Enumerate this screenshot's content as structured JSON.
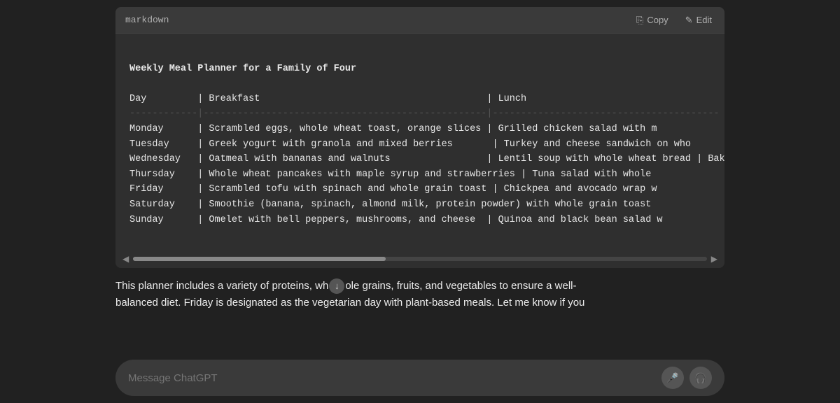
{
  "code_block": {
    "lang": "markdown",
    "title": "Weekly Meal Planner for a Family of Four",
    "copy_label": "Copy",
    "edit_label": "Edit",
    "headers": {
      "day": "Day",
      "breakfast": "Breakfast",
      "lunch": "Lunch"
    },
    "separator": "------------|------------------------------------------|--------------------------------------------",
    "rows": [
      {
        "day": "Monday",
        "breakfast": "Scrambled eggs, whole wheat toast, orange slices",
        "lunch": "Grilled chicken salad with m"
      },
      {
        "day": "Tuesday",
        "breakfast": "Greek yogurt with granola and mixed berries",
        "lunch": "Turkey and cheese sandwich on who"
      },
      {
        "day": "Wednesday",
        "breakfast": "Oatmeal with bananas and walnuts",
        "lunch": "Lentil soup with whole wheat bread | Baked c"
      },
      {
        "day": "Thursday",
        "breakfast": "Whole wheat pancakes with maple syrup and strawberries",
        "lunch": "Tuna salad with whole"
      },
      {
        "day": "Friday",
        "breakfast": "Scrambled tofu with spinach and whole grain toast",
        "lunch": "Chickpea and avocado wrap w"
      },
      {
        "day": "Saturday",
        "breakfast": "Smoothie (banana, spinach, almond milk, protein powder) with whole grain toast",
        "lunch": ""
      },
      {
        "day": "Sunday",
        "breakfast": "Omelet with bell peppers, mushrooms, and cheese",
        "lunch": "Quinoa and black bean salad w"
      }
    ]
  },
  "description": {
    "text_before": "This planner includes a variety of proteins, wh",
    "text_middle": " grains, fruits, and vegetables to ensure a well-balanced diet. Friday is designated as the vegetarian day with plant-based meals. Let me know if you"
  },
  "input_bar": {
    "placeholder": "Message ChatGPT"
  },
  "icons": {
    "copy": "⎘",
    "edit": "✎",
    "scroll_left": "◀",
    "scroll_right": "▶",
    "scroll_down": "↓",
    "mic": "🎤",
    "headphones": "🎧"
  }
}
